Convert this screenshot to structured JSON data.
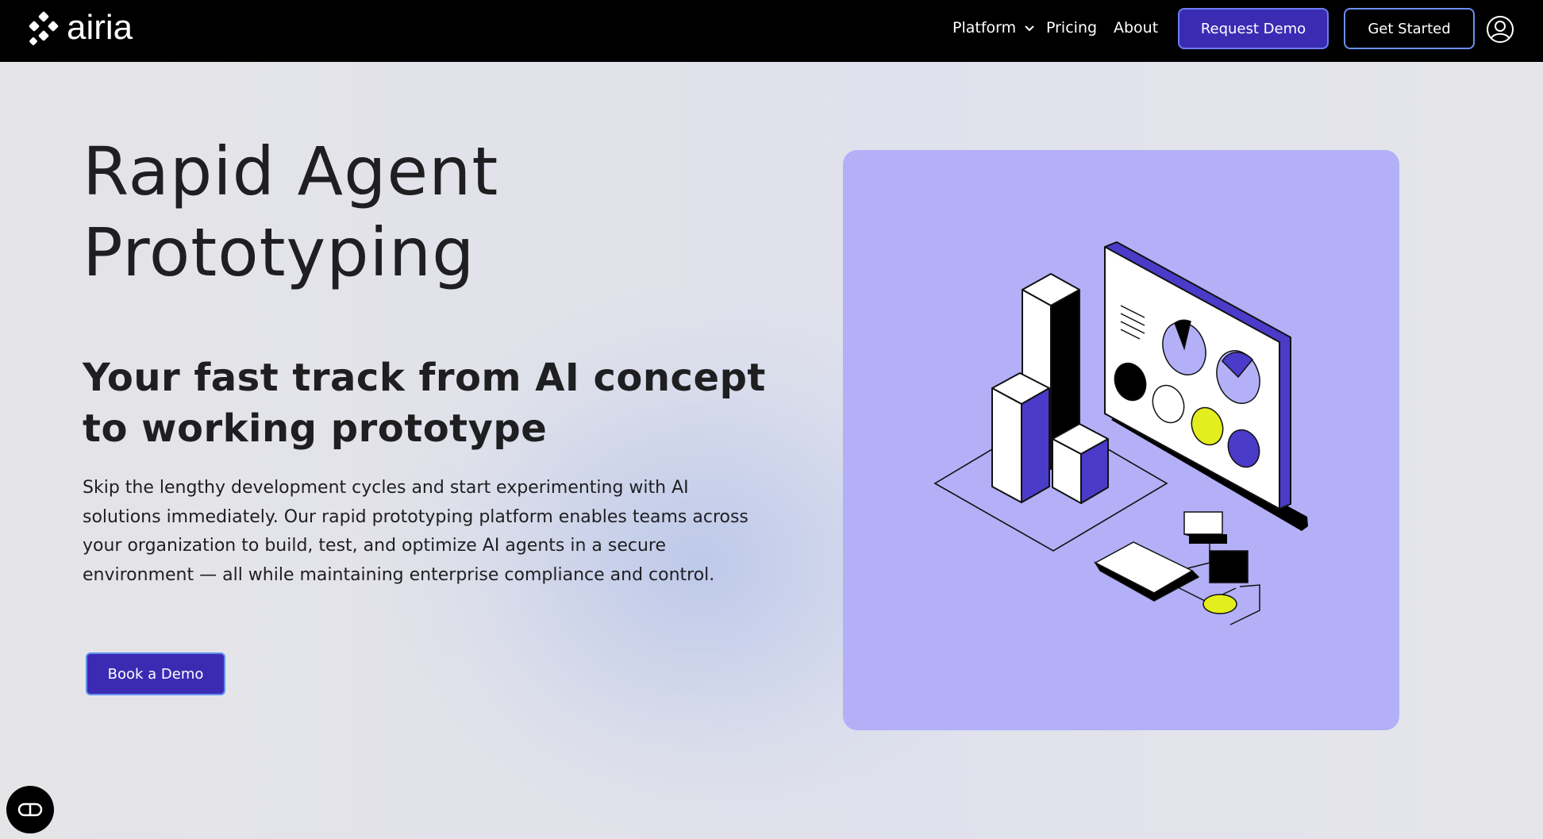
{
  "nav": {
    "logo_text": "airia",
    "links": [
      "Platform",
      "Pricing",
      "About"
    ],
    "request_demo": "Request Demo",
    "get_started": "Get Started"
  },
  "hero": {
    "title_line1": "Rapid Agent",
    "title_line2": "Prototyping",
    "subtitle_line1": "Your fast track from AI concept",
    "subtitle_line2": "to working prototype",
    "body_line1": "Skip the lengthy development cycles and start experimenting with AI",
    "body_line2": "solutions immediately. Our rapid prototyping platform enables teams across",
    "body_line3": "your organization to build, test, and optimize AI agents in a secure",
    "body_line4": "environment — all while maintaining enterprise compliance and control.",
    "cta": "Book a Demo"
  },
  "colors": {
    "nav_bg": "#000000",
    "brand_purple": "#3b2bb3",
    "card_bg": "#b3b0f8",
    "accent_yellow": "#e4ee1c",
    "accent_blue_purple": "#4a3bc9"
  },
  "icons": [
    "airia-logo-icon",
    "chevron-down-icon",
    "user-icon",
    "chat-widget-icon"
  ]
}
